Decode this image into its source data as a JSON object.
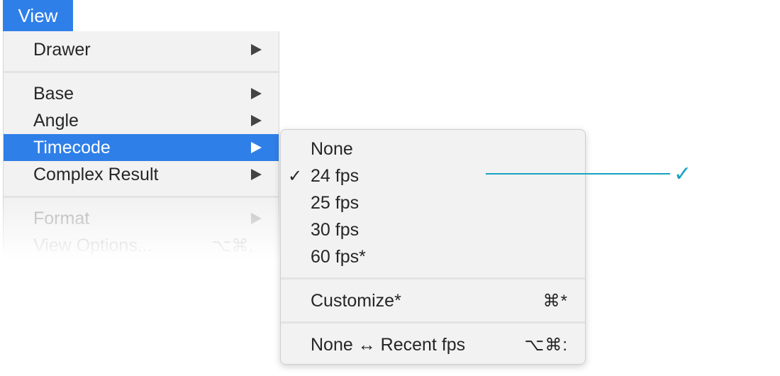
{
  "menubar": {
    "view_label": "View"
  },
  "view_menu": {
    "items": [
      {
        "label": "Drawer",
        "has_submenu": true
      },
      {
        "label": "Base",
        "has_submenu": true
      },
      {
        "label": "Angle",
        "has_submenu": true
      },
      {
        "label": "Timecode",
        "has_submenu": true,
        "selected": true
      },
      {
        "label": "Complex Result",
        "has_submenu": true
      },
      {
        "label": "Format",
        "has_submenu": true,
        "disabled": true
      },
      {
        "label": "View Options...",
        "shortcut": "⌥⌘,",
        "disabled": true
      }
    ]
  },
  "timecode_submenu": {
    "items": [
      {
        "label": "None"
      },
      {
        "label": "24 fps",
        "checked": true,
        "check_mark": "✓"
      },
      {
        "label": "25 fps"
      },
      {
        "label": "30 fps"
      },
      {
        "label": "60 fps*"
      },
      {
        "label": "Customize*",
        "shortcut": "⌘*"
      },
      {
        "label": "None ↔ Recent fps",
        "shortcut": "⌥⌘:"
      }
    ]
  },
  "annotation": {
    "check_mark": "✓",
    "color": "#17a3c4"
  },
  "colors": {
    "selection": "#2f7fe8",
    "menu_bg": "#f2f2f2",
    "disabled_text": "#b3b3b3"
  }
}
